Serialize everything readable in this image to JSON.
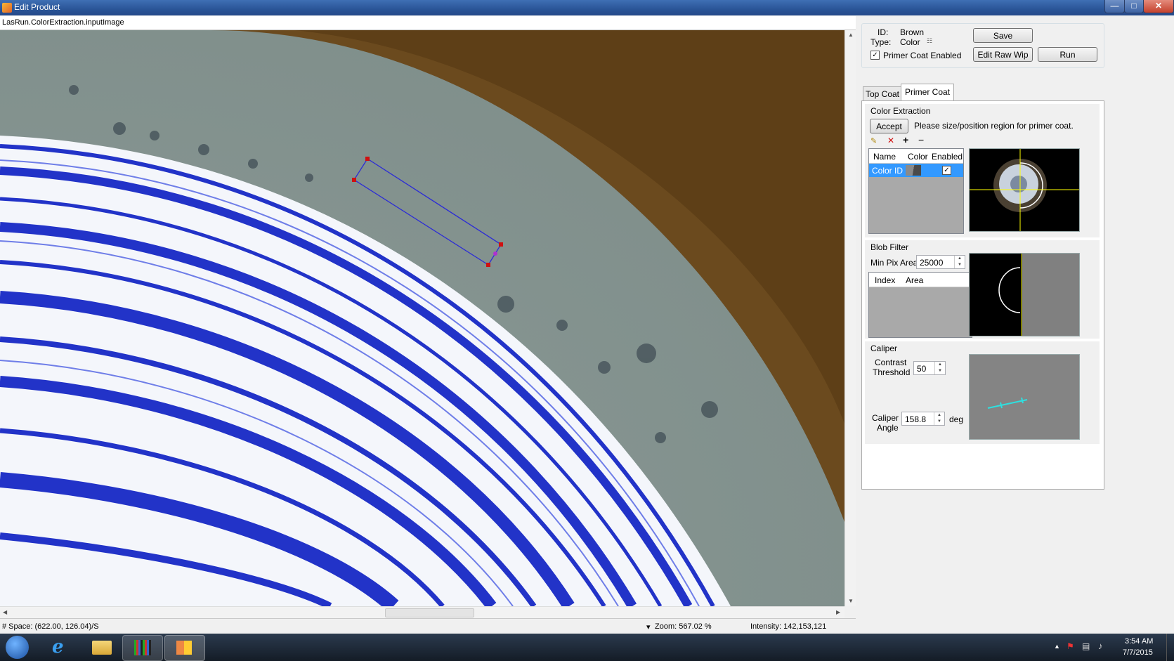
{
  "window": {
    "title": "Edit Product"
  },
  "viewer": {
    "label": "LasRun.ColorExtraction.inputImage"
  },
  "status": {
    "space": "# Space: (622.00, 126.04)/S",
    "zoom": "Zoom: 567.02 %",
    "intensity": "Intensity: 142,153,121"
  },
  "product": {
    "id_label": "ID:",
    "id_value": "Brown",
    "type_label": "Type:",
    "type_value": "Color",
    "primer_enabled_label": "Primer Coat Enabled",
    "primer_enabled_checked": true
  },
  "buttons": {
    "save": "Save",
    "edit_raw_wip": "Edit Raw Wip",
    "run": "Run",
    "accept": "Accept"
  },
  "tabs": [
    {
      "label": "Top Coat",
      "active": false
    },
    {
      "label": "Primer Coat",
      "active": true
    }
  ],
  "color_extraction": {
    "title": "Color Extraction",
    "instruction": "Please size/position region for primer coat.",
    "columns": [
      "Name",
      "Color",
      "Enabled"
    ],
    "rows": [
      {
        "name": "Color ID",
        "enabled": true
      }
    ]
  },
  "blob_filter": {
    "title": "Blob Filter",
    "min_pix_area_label": "Min Pix Area",
    "min_pix_area": "25000",
    "columns": [
      "Index",
      "Area"
    ]
  },
  "caliper": {
    "title": "Caliper",
    "contrast_label_1": "Contrast",
    "contrast_label_2": "Threshold",
    "contrast_threshold": "50",
    "angle_label_1": "Caliper",
    "angle_label_2": "Angle",
    "angle": "158.8",
    "angle_unit": "deg"
  },
  "taskbar": {
    "time": "3:54 AM",
    "date": "7/7/2015"
  },
  "colors": {
    "titlebar": "#2a5597",
    "selection": "#3399ff",
    "roi": "#2b2bd6",
    "handle": "#d01010"
  }
}
